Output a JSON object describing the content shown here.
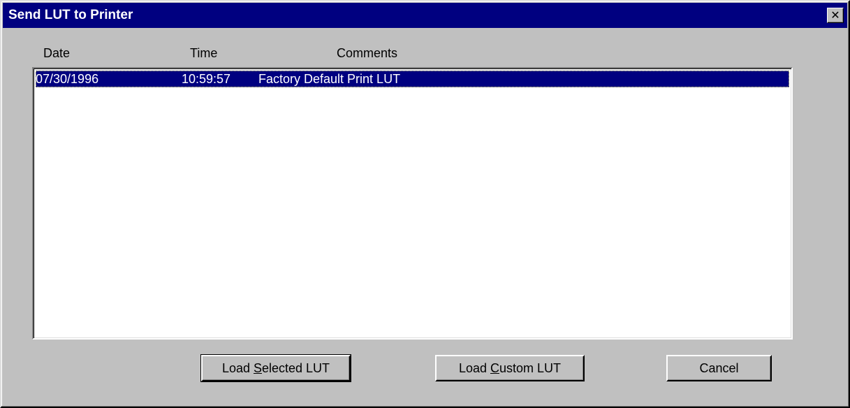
{
  "window": {
    "title": "Send LUT to Printer",
    "close_glyph": "✕"
  },
  "list": {
    "headers": {
      "date": "Date",
      "time": "Time",
      "comments": "Comments"
    },
    "rows": [
      {
        "date": "07/30/1996",
        "time": "10:59:57",
        "comments": "Factory Default Print LUT",
        "selected": true
      }
    ]
  },
  "buttons": {
    "load_selected": {
      "pre": "Load ",
      "accel": "S",
      "post": "elected LUT"
    },
    "load_custom": {
      "pre": "Load ",
      "accel": "C",
      "post": "ustom LUT"
    },
    "cancel": {
      "label": "Cancel"
    }
  },
  "colors": {
    "title_bar": "#000080",
    "selection": "#000080",
    "face": "#c0c0c0"
  },
  "icons": {
    "close": "close-icon"
  }
}
